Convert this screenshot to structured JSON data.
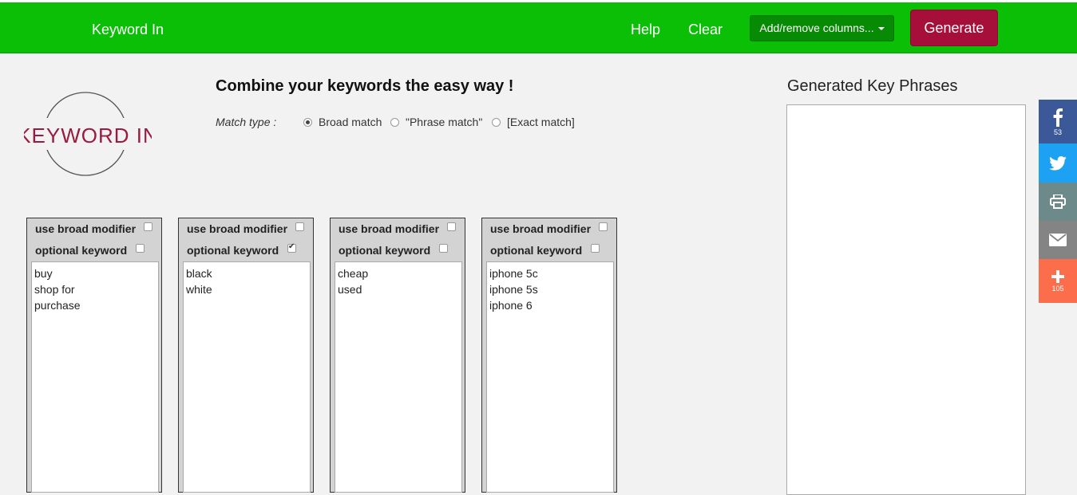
{
  "header": {
    "brand": "Keyword In",
    "help": "Help",
    "clear": "Clear",
    "columns_button": "Add/remove columns...",
    "generate": "Generate"
  },
  "logo": {
    "text": "KeywordIn"
  },
  "main": {
    "headline": "Combine your keywords the easy way !",
    "match_type_label": "Match type :",
    "match_options": [
      {
        "label": "Broad match",
        "selected": true
      },
      {
        "label": "\"Phrase match\"",
        "selected": false
      },
      {
        "label": "[Exact match]",
        "selected": false
      }
    ]
  },
  "columns": [
    {
      "broad_label": "use broad modifier",
      "broad_checked": false,
      "optional_label": "optional keyword",
      "optional_checked": false,
      "keywords": [
        "buy",
        "shop for",
        "purchase"
      ]
    },
    {
      "broad_label": "use broad modifier",
      "broad_checked": false,
      "optional_label": "optional keyword",
      "optional_checked": true,
      "keywords": [
        "black",
        "white"
      ]
    },
    {
      "broad_label": "use broad modifier",
      "broad_checked": false,
      "optional_label": "optional keyword",
      "optional_checked": false,
      "keywords": [
        "cheap",
        "used"
      ]
    },
    {
      "broad_label": "use broad modifier",
      "broad_checked": false,
      "optional_label": "optional keyword",
      "optional_checked": false,
      "keywords": [
        "iphone 5c",
        "iphone 5s",
        "iphone 6"
      ]
    }
  ],
  "output": {
    "title": "Generated Key Phrases"
  },
  "share": {
    "facebook_count": "53",
    "more_count": "105",
    "icons": [
      "facebook-icon",
      "twitter-icon",
      "print-icon",
      "email-icon",
      "plus-icon"
    ]
  },
  "colors": {
    "topbar": "#0bbf06",
    "generate": "#a50f3a",
    "columns_button": "#078a04",
    "logo_accent": "#9b1b3e"
  }
}
